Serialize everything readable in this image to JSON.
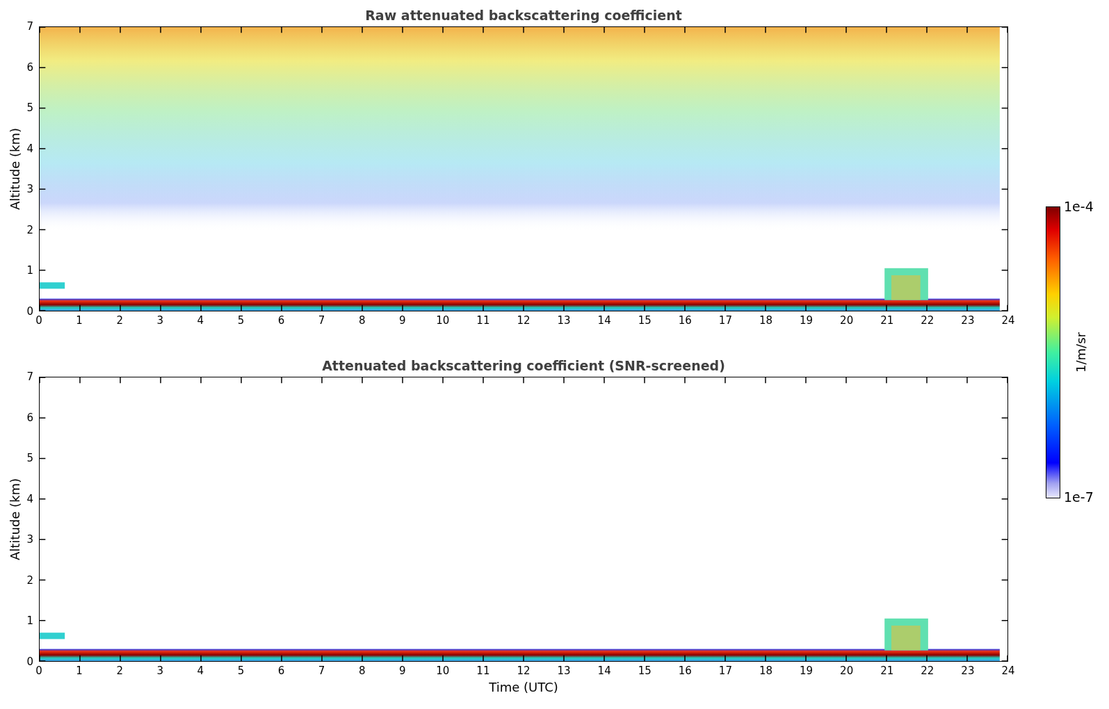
{
  "panels": [
    {
      "title": "Raw attenuated backscattering coefficient",
      "ylabel": "Altitude (km)",
      "kind": "raw",
      "yticks": [
        "7",
        "6",
        "5",
        "4",
        "3",
        "2",
        "1",
        "0"
      ],
      "xticks": [
        "0",
        "1",
        "2",
        "3",
        "4",
        "5",
        "6",
        "7",
        "8",
        "9",
        "10",
        "11",
        "12",
        "13",
        "14",
        "15",
        "16",
        "17",
        "18",
        "19",
        "20",
        "21",
        "22",
        "23",
        "24"
      ]
    },
    {
      "title": "Attenuated backscattering coefficient (SNR-screened)",
      "ylabel": "Altitude (km)",
      "kind": "screened",
      "yticks": [
        "7",
        "6",
        "5",
        "4",
        "3",
        "2",
        "1",
        "0"
      ],
      "xticks": [
        "0",
        "1",
        "2",
        "3",
        "4",
        "5",
        "6",
        "7",
        "8",
        "9",
        "10",
        "11",
        "12",
        "13",
        "14",
        "15",
        "16",
        "17",
        "18",
        "19",
        "20",
        "21",
        "22",
        "23",
        "24"
      ],
      "xlabel": "Time (UTC)"
    }
  ],
  "colorbar": {
    "max_label": "1e-4",
    "min_label": "1e-7",
    "label": "1/m/sr"
  }
}
